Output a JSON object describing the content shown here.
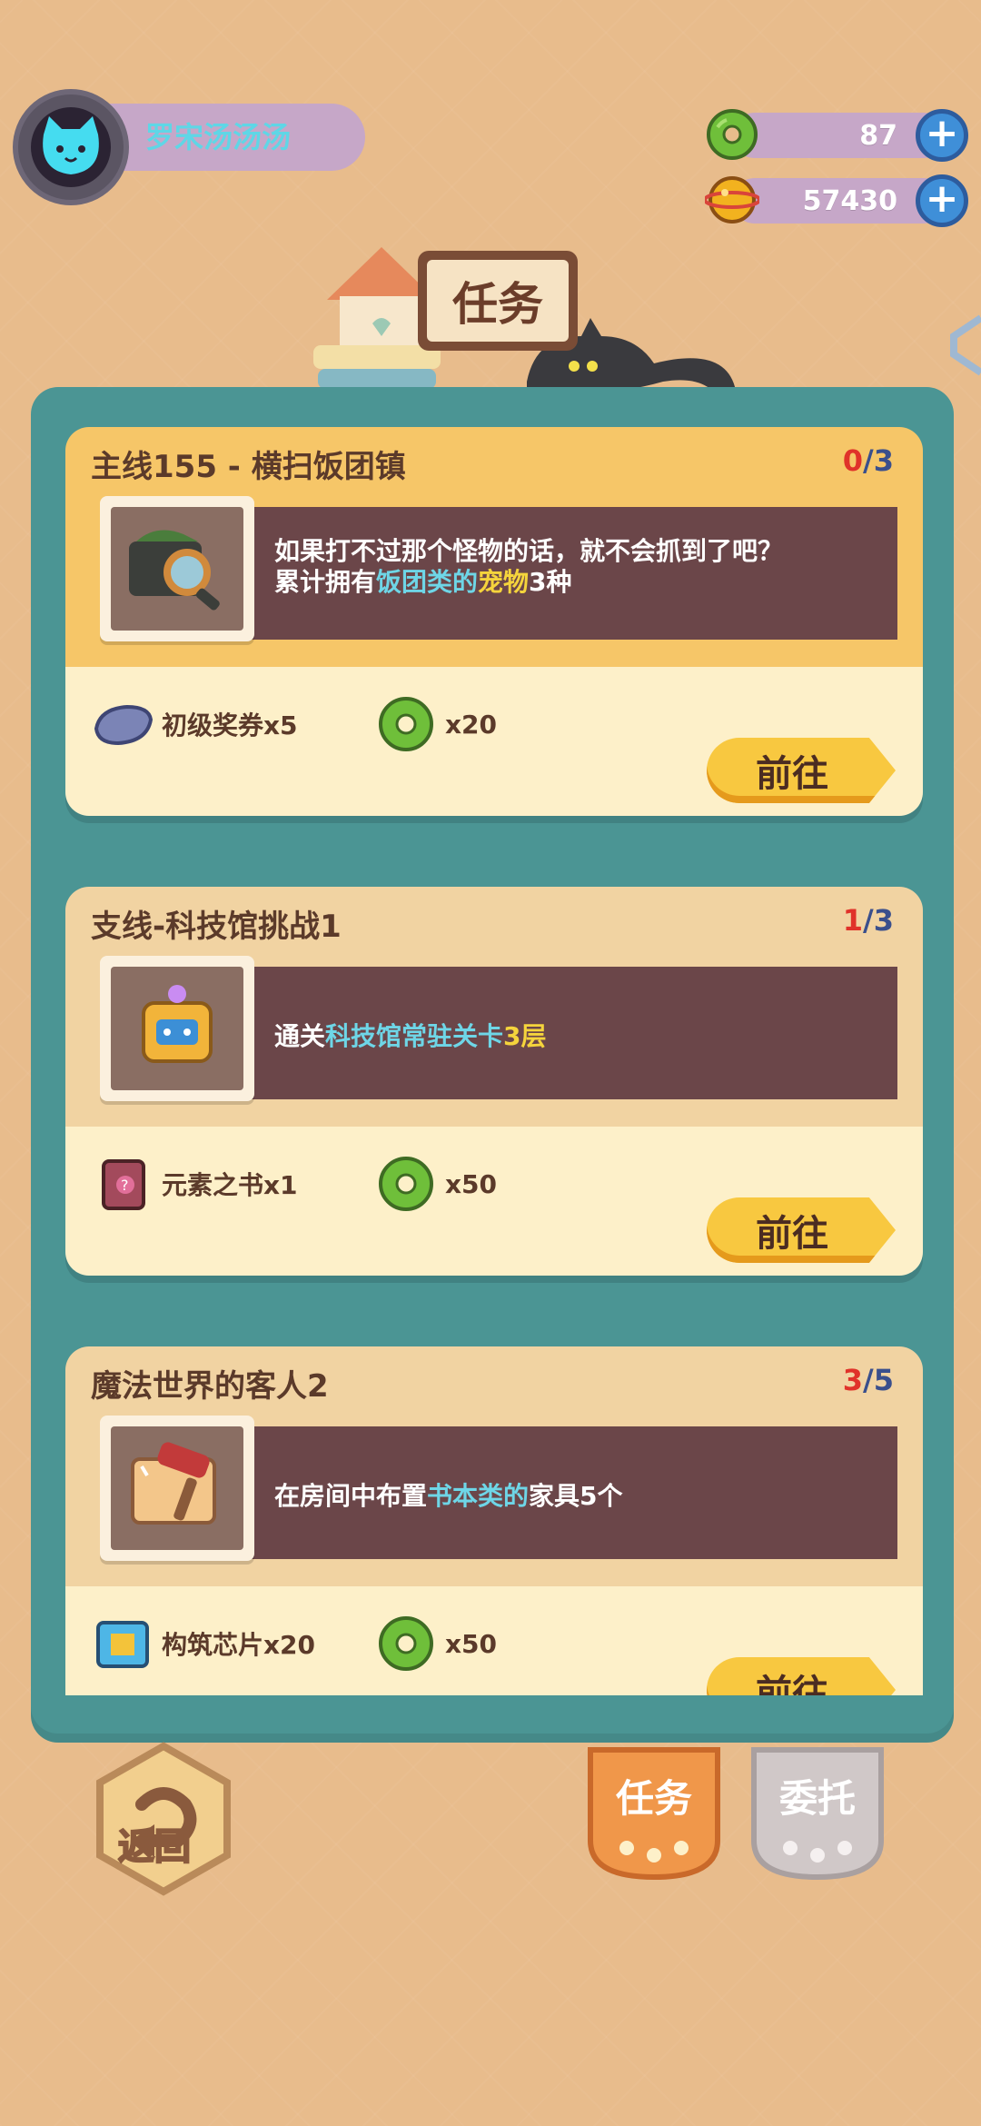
{
  "profile": {
    "name": "罗宋汤汤汤"
  },
  "currencies": [
    {
      "icon": "green-donut-icon",
      "value": "87"
    },
    {
      "icon": "gold-coin-icon",
      "value": "57430"
    }
  ],
  "header": {
    "title": "任务"
  },
  "quests": [
    {
      "type": "main",
      "title": "主线155 - 横扫饭团镇",
      "progress_current": "0",
      "progress_sep": "/",
      "progress_total": "3",
      "thumb_icon": "camera-magnifier-icon",
      "desc_line1": "如果打不过那个怪物的话，就不会抓到了吧？",
      "desc_line2_a": "累计拥有",
      "desc_line2_hl1": "饭团类的",
      "desc_line2_hl2": "宠物",
      "desc_line2_b": "3种",
      "rewards": [
        {
          "icon": "ticket-icon",
          "label": "初级奖券x5"
        },
        {
          "icon": "green-donut-icon",
          "label": "x20"
        }
      ],
      "button": "前往"
    },
    {
      "type": "side",
      "title": "支线-科技馆挑战1",
      "progress_current": "1",
      "progress_sep": "/",
      "progress_total": "3",
      "thumb_icon": "robot-icon",
      "desc_a": "通关",
      "desc_hl": "科技馆常驻关卡",
      "desc_b": "3层",
      "rewards": [
        {
          "icon": "element-book-icon",
          "label": "元素之书x1"
        },
        {
          "icon": "green-donut-icon",
          "label": "x50"
        }
      ],
      "button": "前往"
    },
    {
      "type": "side",
      "title": "魔法世界的客人2",
      "progress_current": "3",
      "progress_sep": "/",
      "progress_total": "5",
      "thumb_icon": "paint-roller-icon",
      "desc_a": "在房间中布置",
      "desc_hl": "书本类的",
      "desc_b": "家具5个",
      "rewards": [
        {
          "icon": "build-chip-icon",
          "label": "构筑芯片x20"
        },
        {
          "icon": "green-donut-icon",
          "label": "x50"
        }
      ],
      "button": "前往"
    }
  ],
  "bottom": {
    "back_label": "返回",
    "tab_tasks": "任务",
    "tab_commission": "委托"
  },
  "colors": {
    "panel": "#4b9594",
    "main_card_header": "#f6c668",
    "side_card_header": "#f1d3a2",
    "button_yellow": "#f8c840",
    "highlight_blue": "#6ed6e7",
    "highlight_yellow": "#f5d43c"
  }
}
